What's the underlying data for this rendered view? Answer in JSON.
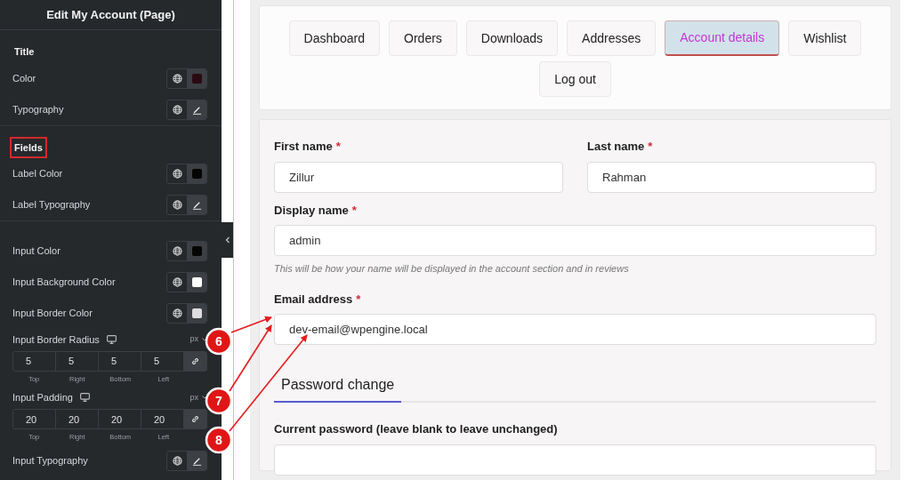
{
  "sidebar": {
    "title": "Edit My Account (Page)",
    "groups": [
      {
        "heading": "Title",
        "highlighted": false,
        "controls": [
          {
            "kind": "color",
            "label": "Color",
            "color": "#2a0a12"
          },
          {
            "kind": "typography",
            "label": "Typography"
          }
        ]
      },
      {
        "heading": "Fields",
        "highlighted": true,
        "controls": [
          {
            "kind": "color",
            "label": "Label Color",
            "color": "#050505"
          },
          {
            "kind": "typography",
            "label": "Label Typography"
          }
        ]
      },
      {
        "controls": [
          {
            "kind": "color",
            "label": "Input Color",
            "color": "#050505"
          },
          {
            "kind": "color",
            "label": "Input Background Color",
            "color": "#ffffff"
          },
          {
            "kind": "color",
            "label": "Input Border Color",
            "color": "#dddddd"
          },
          {
            "kind": "dimensions",
            "label": "Input Border Radius",
            "unit": "px",
            "values": [
              {
                "value": "5",
                "caption": "Top"
              },
              {
                "value": "5",
                "caption": "Right"
              },
              {
                "value": "5",
                "caption": "Bottom"
              },
              {
                "value": "5",
                "caption": "Left"
              }
            ]
          },
          {
            "kind": "dimensions",
            "label": "Input Padding",
            "unit": "px",
            "values": [
              {
                "value": "20",
                "caption": "Top"
              },
              {
                "value": "20",
                "caption": "Right"
              },
              {
                "value": "20",
                "caption": "Bottom"
              },
              {
                "value": "20",
                "caption": "Left"
              }
            ]
          },
          {
            "kind": "typography",
            "label": "Input Typography"
          }
        ]
      }
    ]
  },
  "tabs": [
    {
      "label": "Dashboard",
      "selected": false
    },
    {
      "label": "Orders",
      "selected": false
    },
    {
      "label": "Downloads",
      "selected": false
    },
    {
      "label": "Addresses",
      "selected": false
    },
    {
      "label": "Account details",
      "selected": true
    },
    {
      "label": "Wishlist",
      "selected": false
    },
    {
      "label": "Log out",
      "selected": false
    }
  ],
  "form": {
    "rows": [
      [
        {
          "label": "First name",
          "required_mark": "*",
          "value": "Zillur"
        },
        {
          "label": "Last name",
          "required_mark": "*",
          "value": "Rahman"
        }
      ],
      [
        {
          "label": "Display name",
          "required_mark": "*",
          "value": "admin",
          "hint": "This will be how your name will be displayed in the account section and in reviews"
        }
      ],
      [
        {
          "label": "Email address",
          "required_mark": "*",
          "value": "dev-email@wpengine.local"
        }
      ]
    ],
    "section_title": "Password change",
    "password_fields": [
      {
        "label": "Current password (leave blank to leave unchanged)"
      }
    ]
  },
  "annotations": [
    {
      "number": "6"
    },
    {
      "number": "7"
    },
    {
      "number": "8"
    }
  ]
}
